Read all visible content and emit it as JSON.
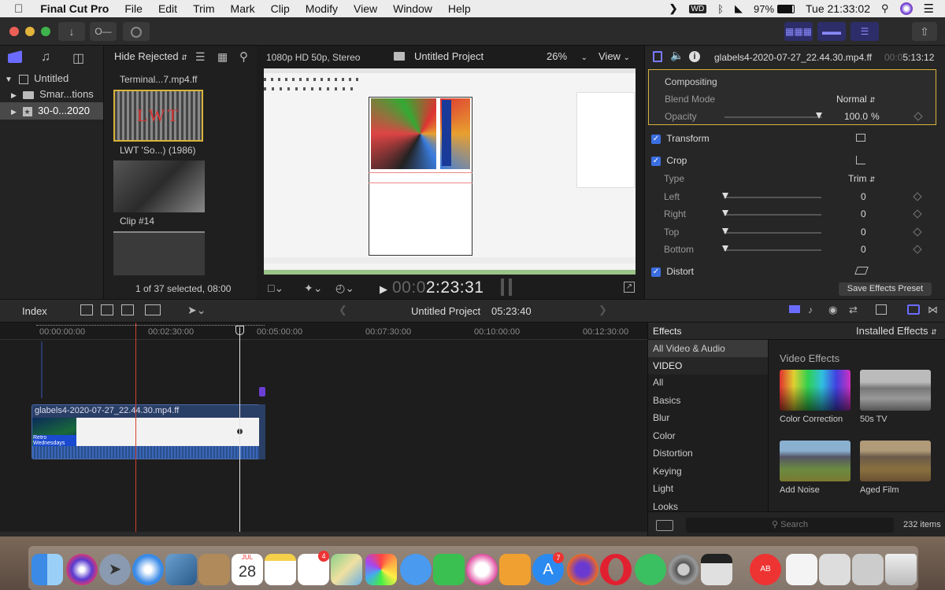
{
  "menubar": {
    "app": "Final Cut Pro",
    "items": [
      "File",
      "Edit",
      "Trim",
      "Mark",
      "Clip",
      "Modify",
      "View",
      "Window",
      "Help"
    ],
    "battery": "97%",
    "clock": "Tue 21:33:02"
  },
  "library": {
    "root": "Untitled",
    "items": [
      "Smar...tions",
      "30-0...2020"
    ]
  },
  "browser": {
    "filter_label": "Hide Rejected",
    "clips": [
      "Terminal...7.mp4.ff",
      "LWT 'So...) (1986)",
      "Clip #14"
    ],
    "status": "1 of 37 selected, 08:00",
    "thumb_text": "LWT"
  },
  "viewer": {
    "format": "1080p HD 50p, Stereo",
    "project": "Untitled Project",
    "zoom": "26%",
    "view_label": "View",
    "timecode": "00:02:23:31",
    "timecode_dim": "00:0",
    "timecode_bright": "2:23:31"
  },
  "inspector": {
    "clip_name": "glabels4-2020-07-27_22.44.30.mp4.ff",
    "duration_dim": "00:0",
    "duration": "5:13:12",
    "compositing": "Compositing",
    "blend_mode_label": "Blend Mode",
    "blend_mode_value": "Normal",
    "opacity_label": "Opacity",
    "opacity_value": "100.0",
    "opacity_unit": "%",
    "transform": "Transform",
    "crop": "Crop",
    "type_label": "Type",
    "type_value": "Trim",
    "left_label": "Left",
    "right_label": "Right",
    "top_label": "Top",
    "bottom_label": "Bottom",
    "zero": "0",
    "distort": "Distort",
    "save_preset": "Save Effects Preset"
  },
  "timeline": {
    "index_label": "Index",
    "project": "Untitled Project",
    "duration": "05:23:40",
    "ruler": [
      "00:00:00:00",
      "00:02:30:00",
      "00:05:00:00",
      "00:07:30:00",
      "00:10:00:00",
      "00:12:30:00"
    ],
    "clip_name": "glabels4-2020-07-27_22.44.30.mp4.ff",
    "clip_thumb_text": "Retro Wednesdays"
  },
  "effects": {
    "title": "Effects",
    "installed": "Installed Effects",
    "categories": [
      "All Video & Audio",
      "VIDEO",
      "All",
      "Basics",
      "Blur",
      "Color",
      "Distortion",
      "Keying",
      "Light",
      "Looks"
    ],
    "section": "Video Effects",
    "items": [
      "Color Correction",
      "50s TV",
      "Add Noise",
      "Aged Film"
    ],
    "search_placeholder": "Search",
    "count": "232 items"
  },
  "dock": {
    "calendar_month": "JUL",
    "calendar_day": "28",
    "badge_reminders": "4",
    "badge_appstore": "7"
  },
  "colors": {
    "accent_blue": "#3b6ee0",
    "selection_yellow": "#d8b43c",
    "playhead_red": "#d04030"
  }
}
